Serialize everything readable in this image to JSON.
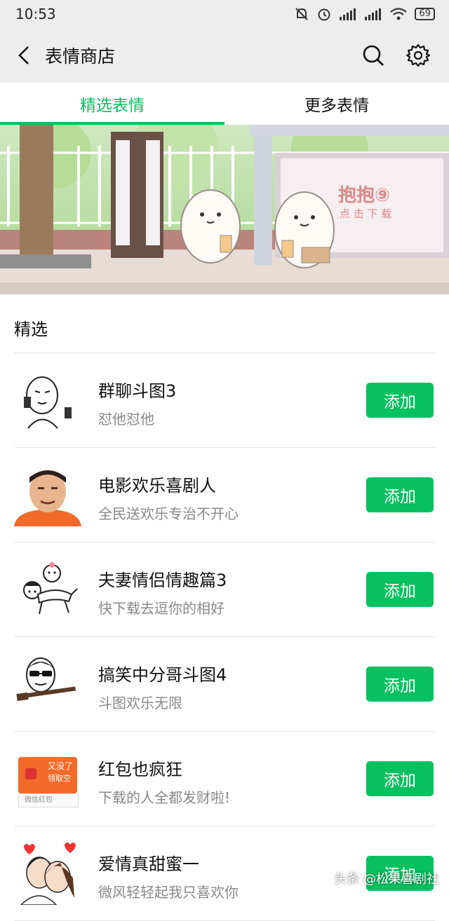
{
  "status_bar": {
    "time": "10:53",
    "battery": "69"
  },
  "header": {
    "title": "表情商店",
    "back_icon": "back-arrow-icon",
    "search_icon": "search-icon",
    "settings_icon": "gear-icon"
  },
  "tabs": [
    {
      "label": "精选表情",
      "active": true
    },
    {
      "label": "更多表情",
      "active": false
    }
  ],
  "banner": {
    "brand_text": "抱抱⑨",
    "sub_text": "点 击 下 载"
  },
  "section": {
    "title": "精选"
  },
  "items": [
    {
      "name": "群聊斗图3",
      "desc": "怼他怼他",
      "button": "添加"
    },
    {
      "name": "电影欢乐喜剧人",
      "desc": "全民送欢乐专治不开心",
      "button": "添加"
    },
    {
      "name": "夫妻情侣情趣篇3",
      "desc": "快下载去逗你的相好",
      "button": "添加"
    },
    {
      "name": "搞笑中分哥斗图4",
      "desc": "斗图欢乐无限",
      "button": "添加"
    },
    {
      "name": "红包也疯狂",
      "desc": "下载的人全都发财啦!",
      "button": "添加"
    },
    {
      "name": "爱情真甜蜜一",
      "desc": "微风轻轻起我只喜欢你",
      "button": "添加"
    }
  ],
  "redpacket_thumb": {
    "line1": "又没了",
    "line2": "领取空",
    "footer": "微信红包"
  },
  "watermark": "头条 @松果喜剧社",
  "colors": {
    "accent": "#07c160",
    "bar_bg": "#ededed"
  }
}
